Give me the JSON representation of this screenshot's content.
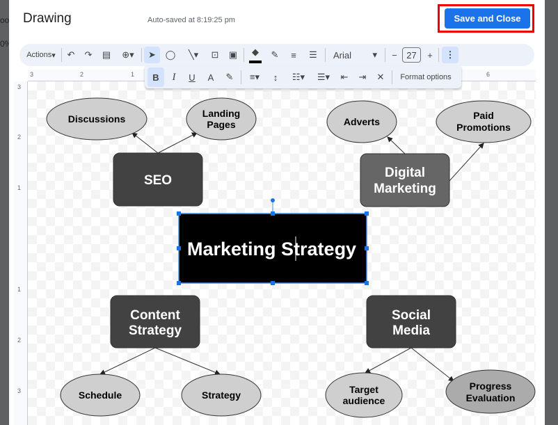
{
  "background": {
    "left_text_1": "oo",
    "left_text_2": "0%"
  },
  "dialog": {
    "title": "Drawing",
    "autosave": "Auto-saved at 8:19:25 pm",
    "save_label": "Save and Close",
    "save_color": "#1a73e8",
    "highlight_color": "#e00000"
  },
  "toolbar": {
    "actions": "Actions",
    "font": "Arial",
    "font_size": "27",
    "minus": "−",
    "plus": "+",
    "icons": [
      "undo-icon",
      "redo-icon",
      "paint-format-icon",
      "zoom-icon",
      "select-icon",
      "shape-icon",
      "line-icon",
      "textbox-icon",
      "image-icon",
      "fill-color-icon",
      "border-color-icon",
      "border-weight-icon",
      "border-dash-icon",
      "more-icon"
    ]
  },
  "format_bar": {
    "bold": "B",
    "italic": "I",
    "underline": "U",
    "text_color": "A",
    "format_options": "Format options"
  },
  "rulers": {
    "top": [
      "3",
      "2",
      "1",
      "6"
    ],
    "left": [
      "3",
      "2",
      "1",
      "1",
      "2",
      "3"
    ]
  },
  "diagram": {
    "center": {
      "text_a": "Marketing S",
      "text_b": "trategy"
    },
    "seo": "SEO",
    "discussions": "Discussions",
    "landing": [
      "Landing",
      "Pages"
    ],
    "digital": [
      "Digital",
      "Marketing"
    ],
    "adverts": "Adverts",
    "paid": [
      "Paid",
      "Promotions"
    ],
    "content": [
      "Content",
      "Strategy"
    ],
    "schedule": "Schedule",
    "strategy": "Strategy",
    "social": [
      "Social",
      "Media"
    ],
    "target": [
      "Target",
      "audience"
    ],
    "progress": [
      "Progress",
      "Evaluation"
    ]
  }
}
